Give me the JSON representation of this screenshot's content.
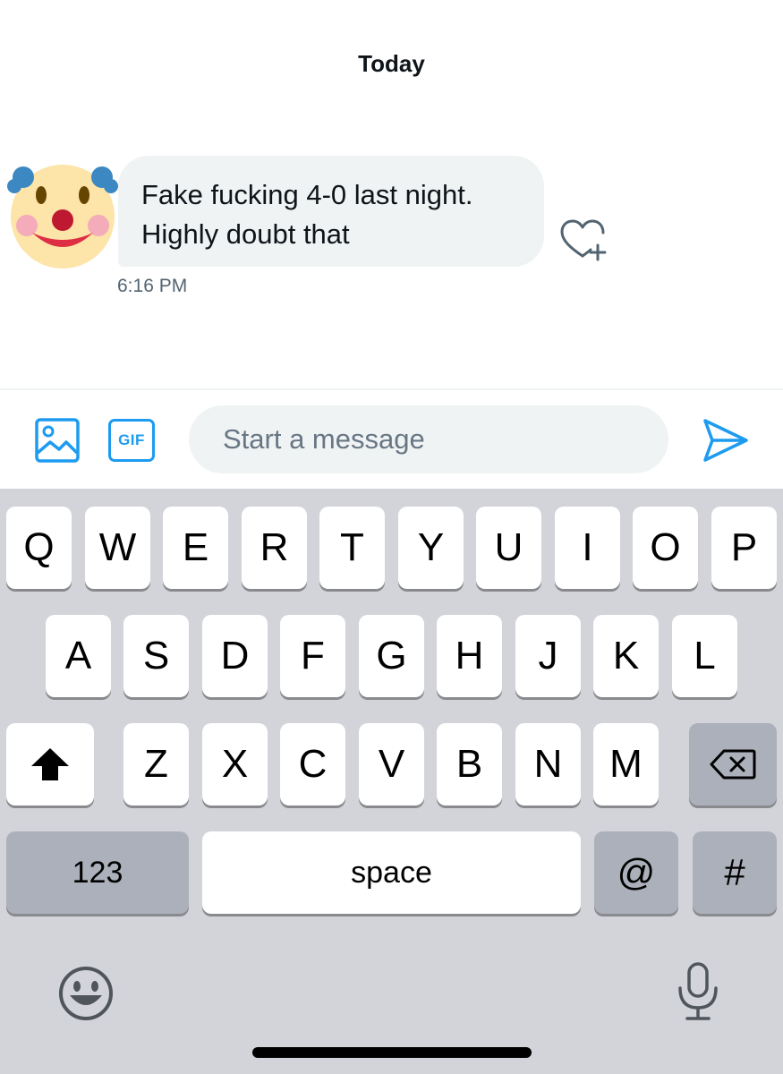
{
  "conversation": {
    "date_label": "Today",
    "message": {
      "lines": [
        "Fake fucking 4-0 last night.",
        "Highly doubt that"
      ],
      "time": "6:16 PM",
      "sender_avatar": "clown-face-emoji"
    }
  },
  "composer": {
    "placeholder": "Start a message",
    "gif_label": "GIF",
    "media_icon": "image-icon",
    "send_icon": "send-icon"
  },
  "keyboard": {
    "row1": [
      "Q",
      "W",
      "E",
      "R",
      "T",
      "Y",
      "U",
      "I",
      "O",
      "P"
    ],
    "row2": [
      "A",
      "S",
      "D",
      "F",
      "G",
      "H",
      "J",
      "K",
      "L"
    ],
    "row3": [
      "Z",
      "X",
      "C",
      "V",
      "B",
      "N",
      "M"
    ],
    "bottom": {
      "numbers_label": "123",
      "space_label": "space",
      "at_label": "@",
      "hash_label": "#"
    },
    "shift_icon": "shift-icon",
    "delete_icon": "backspace-icon",
    "emoji_icon": "emoji-icon",
    "mic_icon": "microphone-icon"
  },
  "colors": {
    "accent": "#1d9bf0",
    "bubble": "#eff3f4",
    "keyboard_bg": "#d2d4da",
    "dark_key": "#abb0ba"
  }
}
